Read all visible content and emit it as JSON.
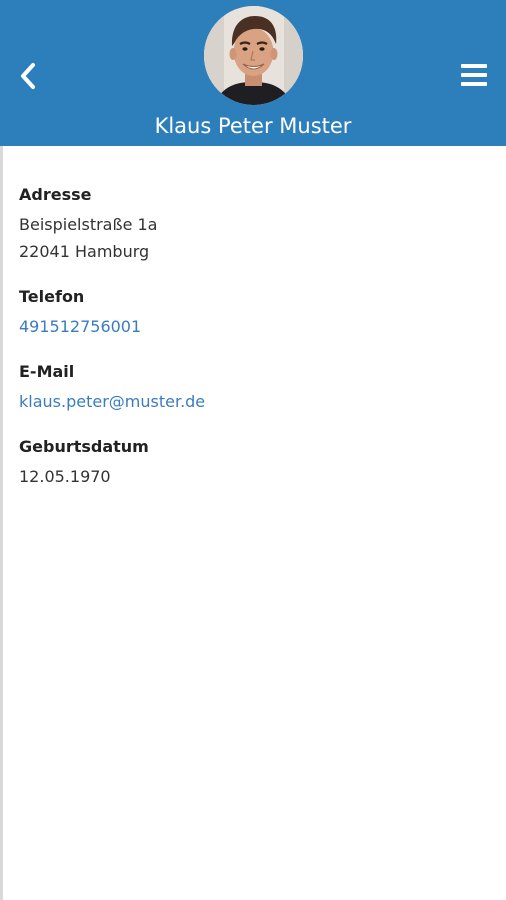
{
  "header": {
    "name": "Klaus Peter Muster",
    "back_icon": "chevron-left-icon",
    "menu_icon": "hamburger-menu-icon",
    "color": "#2d7fbc"
  },
  "fields": {
    "address": {
      "label": "Adresse",
      "line1": "Beispielstraße 1a",
      "line2": "22041 Hamburg"
    },
    "phone": {
      "label": "Telefon",
      "value": "491512756001"
    },
    "email": {
      "label": "E-Mail",
      "value": "klaus.peter@muster.de"
    },
    "birthday": {
      "label": "Geburtsdatum",
      "value": "12.05.1970"
    }
  },
  "colors": {
    "link": "#3a7cc0",
    "text": "#333333"
  }
}
